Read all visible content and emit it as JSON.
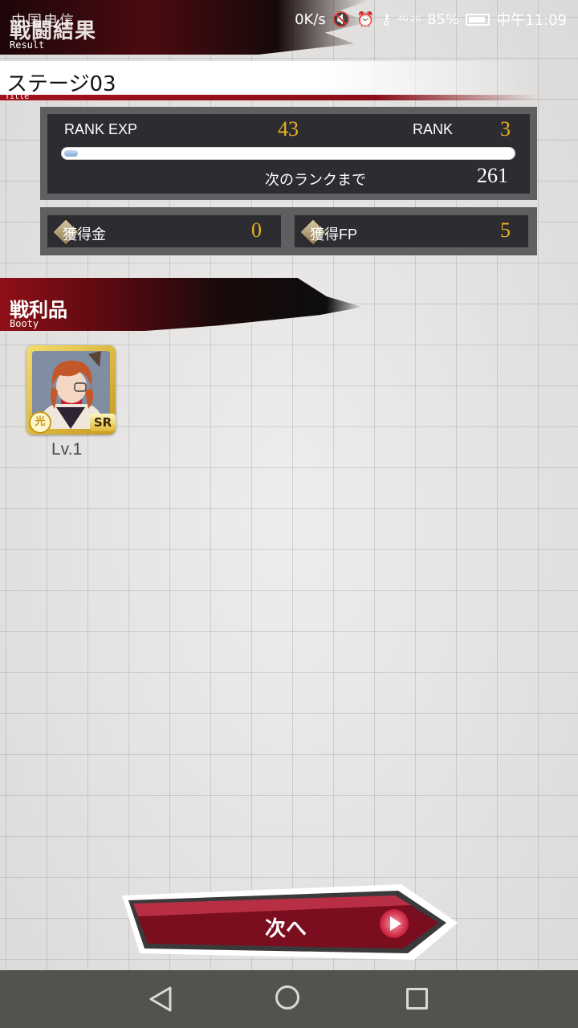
{
  "status_bar": {
    "carrier": "中国电信",
    "speed": "0K/s",
    "network": "4G 2G",
    "battery": "85%",
    "time": "中午11:09"
  },
  "header": {
    "title": "戦闘結果",
    "subtitle": "Result"
  },
  "stage": {
    "title": "ステージ03",
    "subtitle": "Title"
  },
  "rank": {
    "exp_label": "RANK EXP",
    "exp_value": "43",
    "rank_label": "RANK",
    "rank_value": "3",
    "next_label": "次のランクまで",
    "next_value": "261",
    "exp_progress": 0.03
  },
  "earnings": {
    "money_label": "獲得金",
    "money_value": "0",
    "fp_label": "獲得FP",
    "fp_value": "5"
  },
  "booty": {
    "title": "戦利品",
    "subtitle": "Booty",
    "items": [
      {
        "rarity": "SR",
        "attribute": "光",
        "level": "Lv.1"
      }
    ]
  },
  "next_button": {
    "label": "次へ"
  },
  "colors": {
    "accent_red": "#8e0f18",
    "gold": "#e8b222",
    "panel_dark": "#2d2d31"
  }
}
